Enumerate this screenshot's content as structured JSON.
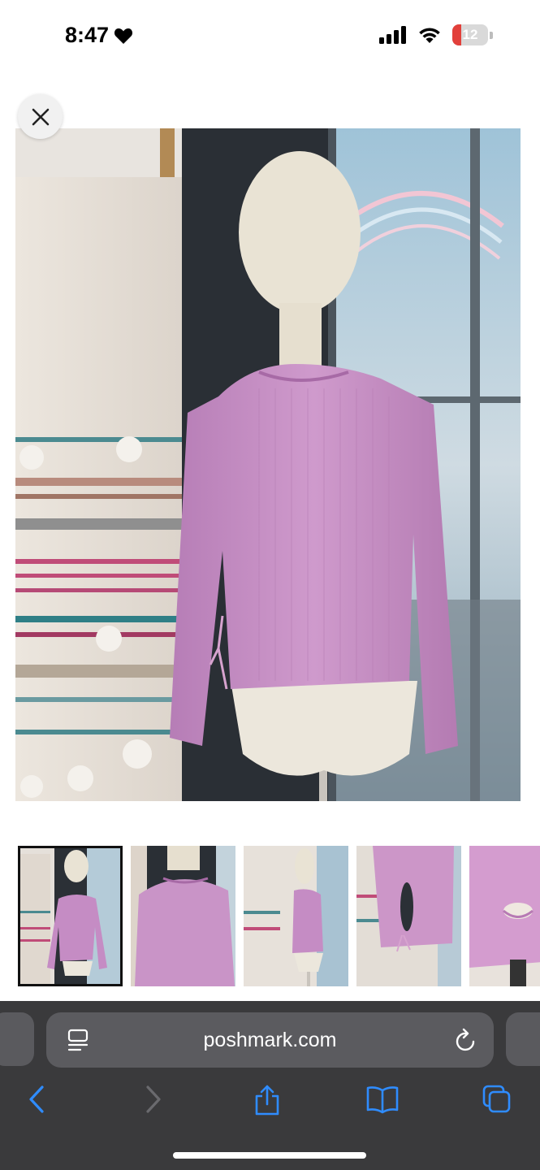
{
  "status_bar": {
    "time": "8:47",
    "battery_level": "12",
    "focus_icon": "heart-icon"
  },
  "product": {
    "close_icon": "close-icon",
    "main_image_description": "",
    "thumbnails_count": 5,
    "selected_thumbnail": 0
  },
  "browser": {
    "address": "poshmark.com",
    "reader_icon": "page-menu-icon",
    "reload_icon": "reload-icon",
    "toolbar": [
      "back-icon",
      "forward-icon",
      "share-icon",
      "bookmarks-icon",
      "tabs-icon"
    ]
  },
  "colors": {
    "sweater": "#c58cc4",
    "toolbar_bg": "#3a3a3c",
    "accent": "#2f8cff"
  }
}
